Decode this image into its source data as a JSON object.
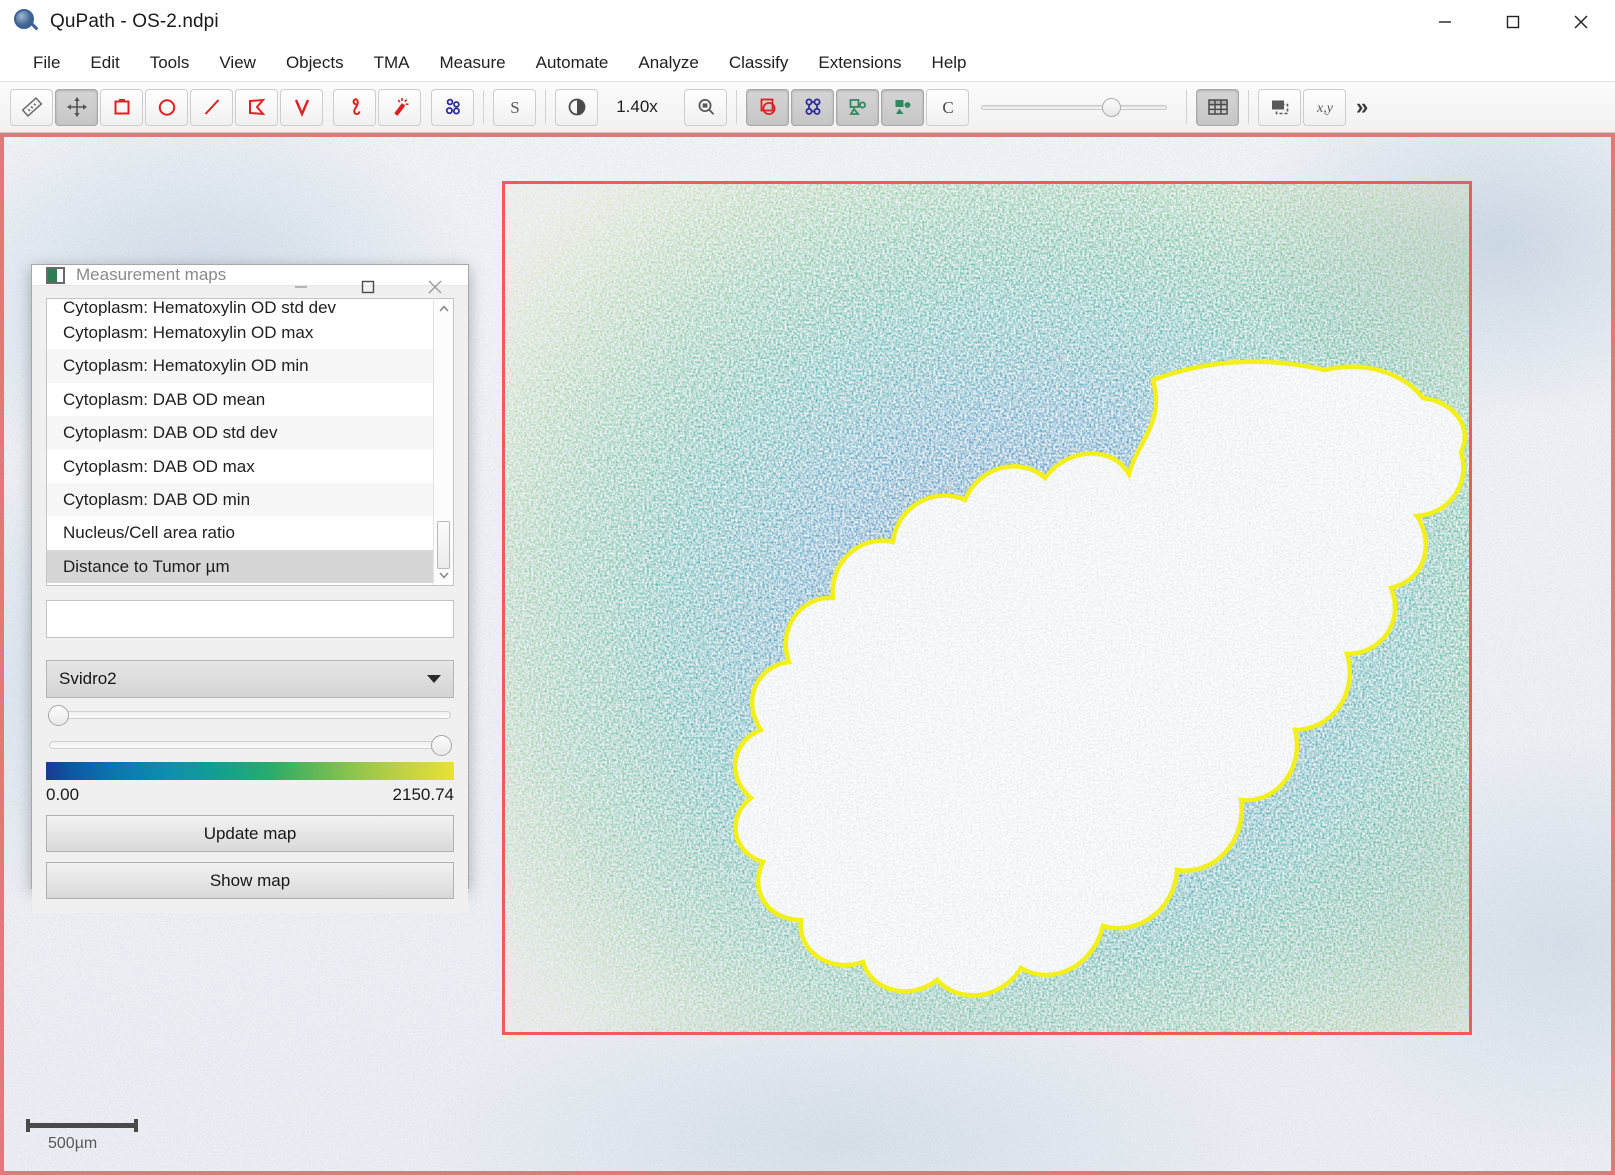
{
  "window": {
    "title": "QuPath - OS-2.ndpi",
    "app_icon": "qupath-magnifier-icon",
    "controls": {
      "minimize": "minimize-icon",
      "maximize": "maximize-icon",
      "close": "close-icon"
    }
  },
  "menubar": {
    "items": [
      {
        "label": "File"
      },
      {
        "label": "Edit"
      },
      {
        "label": "Tools"
      },
      {
        "label": "View"
      },
      {
        "label": "Objects"
      },
      {
        "label": "TMA"
      },
      {
        "label": "Measure"
      },
      {
        "label": "Automate"
      },
      {
        "label": "Analyze"
      },
      {
        "label": "Classify"
      },
      {
        "label": "Extensions"
      },
      {
        "label": "Help"
      }
    ]
  },
  "toolbar": {
    "zoom_value": "1.40x",
    "overflow_label": "»",
    "tools": [
      {
        "name": "ruler-measure-tool",
        "pressed": false
      },
      {
        "name": "move-pan-tool",
        "pressed": true
      },
      {
        "name": "rectangle-tool",
        "pressed": false
      },
      {
        "name": "ellipse-tool",
        "pressed": false
      },
      {
        "name": "line-tool",
        "pressed": false
      },
      {
        "name": "polygon-tool",
        "pressed": false
      },
      {
        "name": "polyline-tool",
        "pressed": false
      },
      {
        "name": "brush-tool",
        "pressed": false
      },
      {
        "name": "wand-tool",
        "pressed": false
      },
      {
        "name": "points-tool",
        "pressed": false
      },
      {
        "name": "selection-mode-tool",
        "pressed": false
      },
      {
        "name": "brightness-contrast-tool",
        "pressed": false
      },
      {
        "name": "zoom-to-fit-button",
        "pressed": false
      },
      {
        "name": "show-annotations-toggle",
        "pressed": true
      },
      {
        "name": "show-detections-toggle",
        "pressed": true
      },
      {
        "name": "fill-annotations-toggle",
        "pressed": true
      },
      {
        "name": "fill-detections-toggle",
        "pressed": true
      },
      {
        "name": "show-classification-toggle",
        "pressed": false
      },
      {
        "name": "show-grid-toggle",
        "pressed": true
      },
      {
        "name": "show-overview-toggle",
        "pressed": false
      },
      {
        "name": "show-location-toggle",
        "pressed": false
      }
    ]
  },
  "viewer": {
    "scalebar_label": "500µm",
    "annotation_color": "#f05a5a",
    "tumor_outline_color": "#f2ef19"
  },
  "dialog": {
    "title": "Measurement maps",
    "icon": "measurement-map-icon",
    "controls": {
      "minimize": "minimize-icon",
      "maximize": "maximize-icon",
      "close": "close-icon"
    },
    "measurement_list": {
      "partial_top_item": "Cytoplasm: Hematoxylin OD std dev",
      "items": [
        "Cytoplasm: Hematoxylin OD max",
        "Cytoplasm: Hematoxylin OD min",
        "Cytoplasm: DAB OD mean",
        "Cytoplasm: DAB OD std dev",
        "Cytoplasm: DAB OD max",
        "Cytoplasm: DAB OD min",
        "Nucleus/Cell area ratio",
        "Distance to Tumor µm"
      ],
      "selected": "Distance to Tumor µm"
    },
    "text_field_value": "",
    "text_field_placeholder": "",
    "colormap_select": {
      "selected": "Svidro2",
      "options": [
        "Svidro2"
      ]
    },
    "range_min_label": "0.00",
    "range_max_label": "2150.74",
    "colorbar_stops": [
      "#1a3a8f",
      "#0b57a3",
      "#0c74ae",
      "#0d8fae",
      "#12a18e",
      "#2aab6c",
      "#61b855",
      "#96c64c",
      "#c3d241",
      "#e8e234"
    ],
    "buttons": {
      "update_map": "Update map",
      "show_map": "Show map"
    }
  }
}
